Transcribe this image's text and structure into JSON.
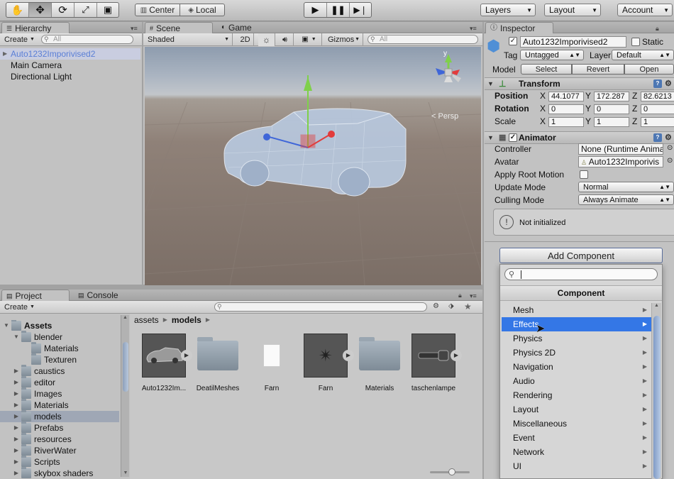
{
  "toolbar": {
    "pivot_label": "Center",
    "space_label": "Local",
    "layers_label": "Layers",
    "layout_label": "Layout",
    "account_label": "Account"
  },
  "hierarchy": {
    "tab": "Hierarchy",
    "create_label": "Create",
    "search_placeholder": "All",
    "items": [
      "Auto1232Imporivised2",
      "Main Camera",
      "Directional Light"
    ]
  },
  "scene": {
    "tab_scene": "Scene",
    "tab_game": "Game",
    "shading_mode": "Shaded",
    "mode_2d": "2D",
    "gizmos_label": "Gizmos",
    "search_placeholder": "All",
    "persp_label": "Persp",
    "gizmo_y": "y"
  },
  "project": {
    "tab_project": "Project",
    "tab_console": "Console",
    "create_label": "Create",
    "breadcrumb": [
      "assets",
      "models"
    ],
    "tree": [
      {
        "label": "Assets",
        "indent": 0,
        "open": true
      },
      {
        "label": "blender",
        "indent": 1,
        "open": true
      },
      {
        "label": "Materials",
        "indent": 2,
        "open": false
      },
      {
        "label": "Texturen",
        "indent": 2,
        "open": false
      },
      {
        "label": "caustics",
        "indent": 1,
        "open": false
      },
      {
        "label": "editor",
        "indent": 1,
        "open": false
      },
      {
        "label": "Images",
        "indent": 1,
        "open": false
      },
      {
        "label": "Materials",
        "indent": 1,
        "open": false
      },
      {
        "label": "models",
        "indent": 1,
        "open": false
      },
      {
        "label": "Prefabs",
        "indent": 1,
        "open": false
      },
      {
        "label": "resources",
        "indent": 1,
        "open": false
      },
      {
        "label": "RiverWater",
        "indent": 1,
        "open": false
      },
      {
        "label": "Scripts",
        "indent": 1,
        "open": false
      },
      {
        "label": "skybox shaders",
        "indent": 1,
        "open": false
      }
    ],
    "assets": [
      {
        "label": "Auto1232Im...",
        "kind": "model"
      },
      {
        "label": "DeatilMeshes",
        "kind": "folder"
      },
      {
        "label": "Farn",
        "kind": "file"
      },
      {
        "label": "Farn",
        "kind": "model"
      },
      {
        "label": "Materials",
        "kind": "folder"
      },
      {
        "label": "taschenlampe",
        "kind": "model"
      }
    ]
  },
  "inspector": {
    "tab": "Inspector",
    "object_name": "Auto1232Imporivised2",
    "static_label": "Static",
    "tag_label": "Tag",
    "tag_value": "Untagged",
    "layer_label": "Layer",
    "layer_value": "Default",
    "model_label": "Model",
    "model_select": "Select",
    "model_revert": "Revert",
    "model_open": "Open",
    "transform": {
      "title": "Transform",
      "position_label": "Position",
      "rotation_label": "Rotation",
      "scale_label": "Scale",
      "position": [
        "44.1077",
        "172.287",
        "82.6213"
      ],
      "rotation": [
        "0",
        "0",
        "0"
      ],
      "scale": [
        "1",
        "1",
        "1"
      ],
      "axes": [
        "X",
        "Y",
        "Z"
      ]
    },
    "animator": {
      "title": "Animator",
      "controller_label": "Controller",
      "controller_value": "None (Runtime Anima",
      "avatar_label": "Avatar",
      "avatar_value": "Auto1232Imporivis",
      "apply_root_motion_label": "Apply Root Motion",
      "update_mode_label": "Update Mode",
      "update_mode_value": "Normal",
      "culling_mode_label": "Culling Mode",
      "culling_mode_value": "Always Animate",
      "notice": "Not initialized"
    },
    "add_component_label": "Add Component",
    "component_header": "Component",
    "component_menu": [
      "Mesh",
      "Effects",
      "Physics",
      "Physics 2D",
      "Navigation",
      "Audio",
      "Rendering",
      "Layout",
      "Miscellaneous",
      "Event",
      "Network",
      "UI"
    ],
    "highlighted_item": "Effects"
  }
}
